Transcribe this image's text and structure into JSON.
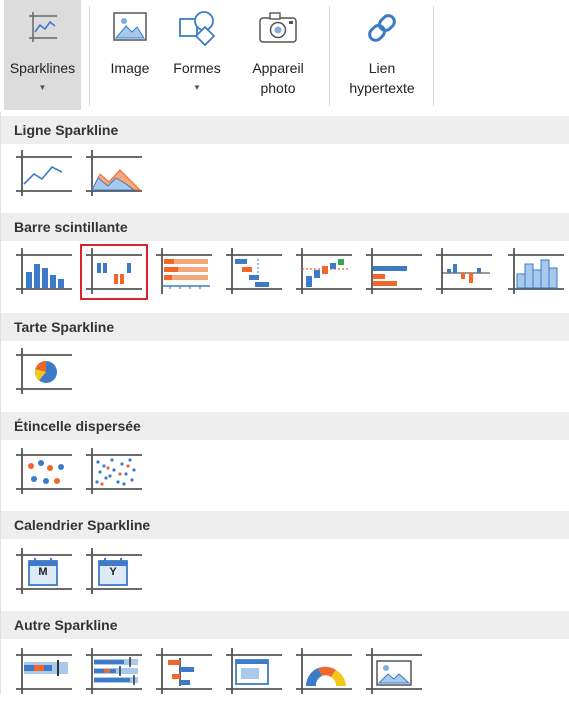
{
  "ribbon": {
    "buttons": [
      {
        "label": "Sparklines"
      },
      {
        "label": "Image"
      },
      {
        "label": "Formes"
      },
      {
        "label": "Appareil photo"
      },
      {
        "label": "Lien hypertexte"
      }
    ]
  },
  "sections": [
    {
      "title": "Ligne Sparkline",
      "items": [
        "line-sparkline-icon",
        "area-sparkline-icon"
      ]
    },
    {
      "title": "Barre scintillante",
      "items": [
        "column-sparkline-icon",
        "winloss-sparkline-icon",
        "stacked-bar-sparkline-icon",
        "cascade-sparkline-icon",
        "vertical-cascade-sparkline-icon",
        "bar-sparkline-icon",
        "variance-sparkline-icon",
        "histogram-sparkline-icon"
      ]
    },
    {
      "title": "Tarte Sparkline",
      "items": [
        "pie-sparkline-icon"
      ]
    },
    {
      "title": "Étincelle dispersée",
      "items": [
        "scatter-sparkline-icon",
        "spread-sparkline-icon"
      ]
    },
    {
      "title": "Calendrier Sparkline",
      "items": [
        "month-calendar-sparkline-icon",
        "year-calendar-sparkline-icon"
      ]
    },
    {
      "title": "Autre Sparkline",
      "items": [
        "bullet-sparkline-icon",
        "boxplot-sparkline-icon",
        "hbar-sparkline-icon",
        "image-sparkline-icon",
        "gauge-sparkline-icon",
        "picture-sparkline-icon"
      ]
    }
  ],
  "calendar_letters": {
    "month": "M",
    "year": "Y"
  },
  "colors": {
    "blue": "#3d7bc8",
    "orange": "#f0662b",
    "selection": "#d9252b"
  }
}
